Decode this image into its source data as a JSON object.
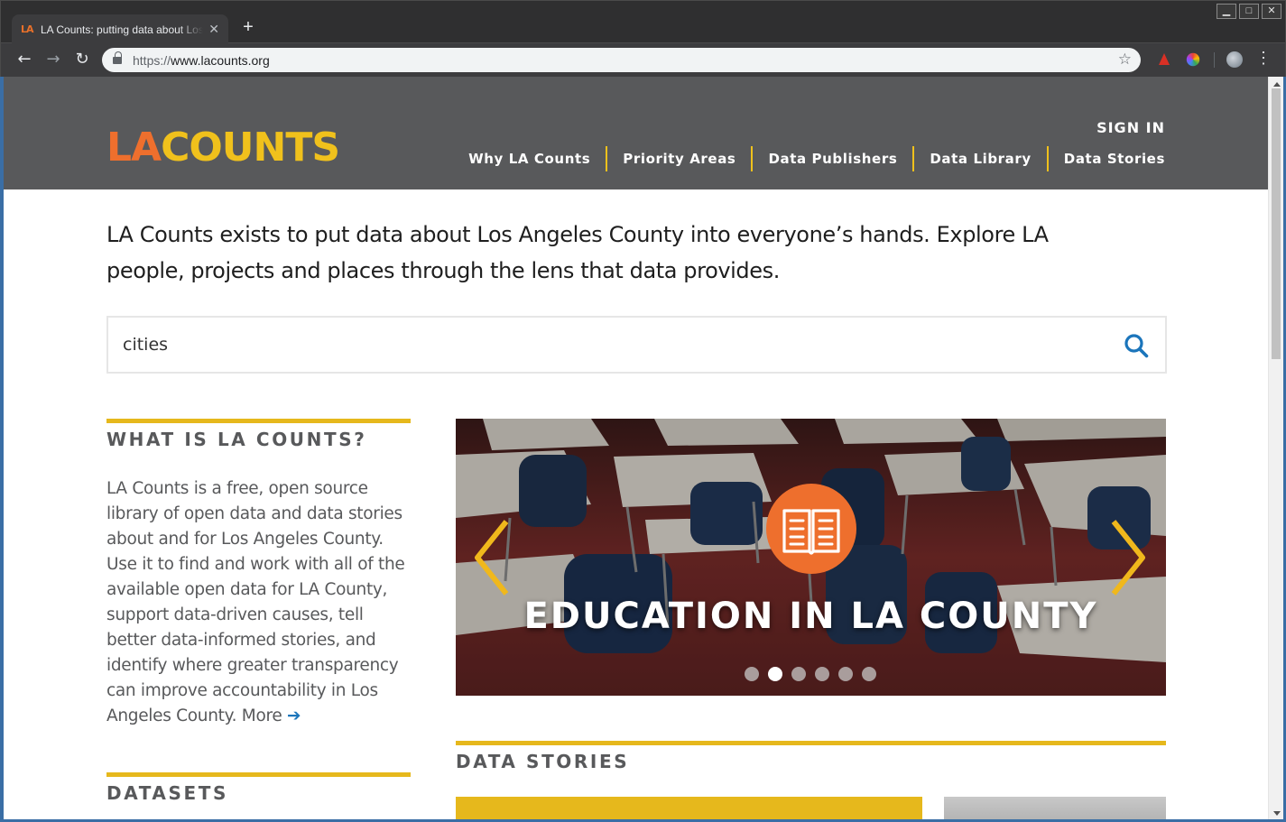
{
  "browser": {
    "tab_title": "LA Counts: putting data about Los Angeles",
    "tab_favicon": "LA",
    "url_scheme": "https://",
    "url_host": "www.lacounts.org",
    "new_tab_symbol": "+",
    "close_symbol": "✕"
  },
  "site": {
    "logo_la": "LA",
    "logo_counts": "COUNTS",
    "sign_in": "SIGN IN",
    "nav": [
      "Why LA Counts",
      "Priority Areas",
      "Data Publishers",
      "Data Library",
      "Data Stories"
    ]
  },
  "intro_text": "LA Counts exists to put data about Los Angeles County into everyone’s hands. Explore LA people, projects and places through the lens that data provides.",
  "search": {
    "value": "cities"
  },
  "what_is": {
    "title": "WHAT IS LA COUNTS?",
    "body": "LA Counts is a free, open source library of open data and data stories about and for Los Angeles County. Use it to find and work with all of the available open data for LA County, support data-driven causes, tell better data-informed stories, and identify where greater transparency can improve accountability in Los Angeles County.",
    "more": "More"
  },
  "datasets": {
    "title": "DATASETS"
  },
  "carousel": {
    "title": "EDUCATION IN LA COUNTY",
    "dot_count": 6,
    "active_index": 1
  },
  "data_stories": {
    "title": "DATA STORIES"
  },
  "colors": {
    "header_bg": "#58595b",
    "accent_yellow": "#e6b81c",
    "accent_orange": "#ee6f2d",
    "link_blue": "#1b75bb"
  }
}
